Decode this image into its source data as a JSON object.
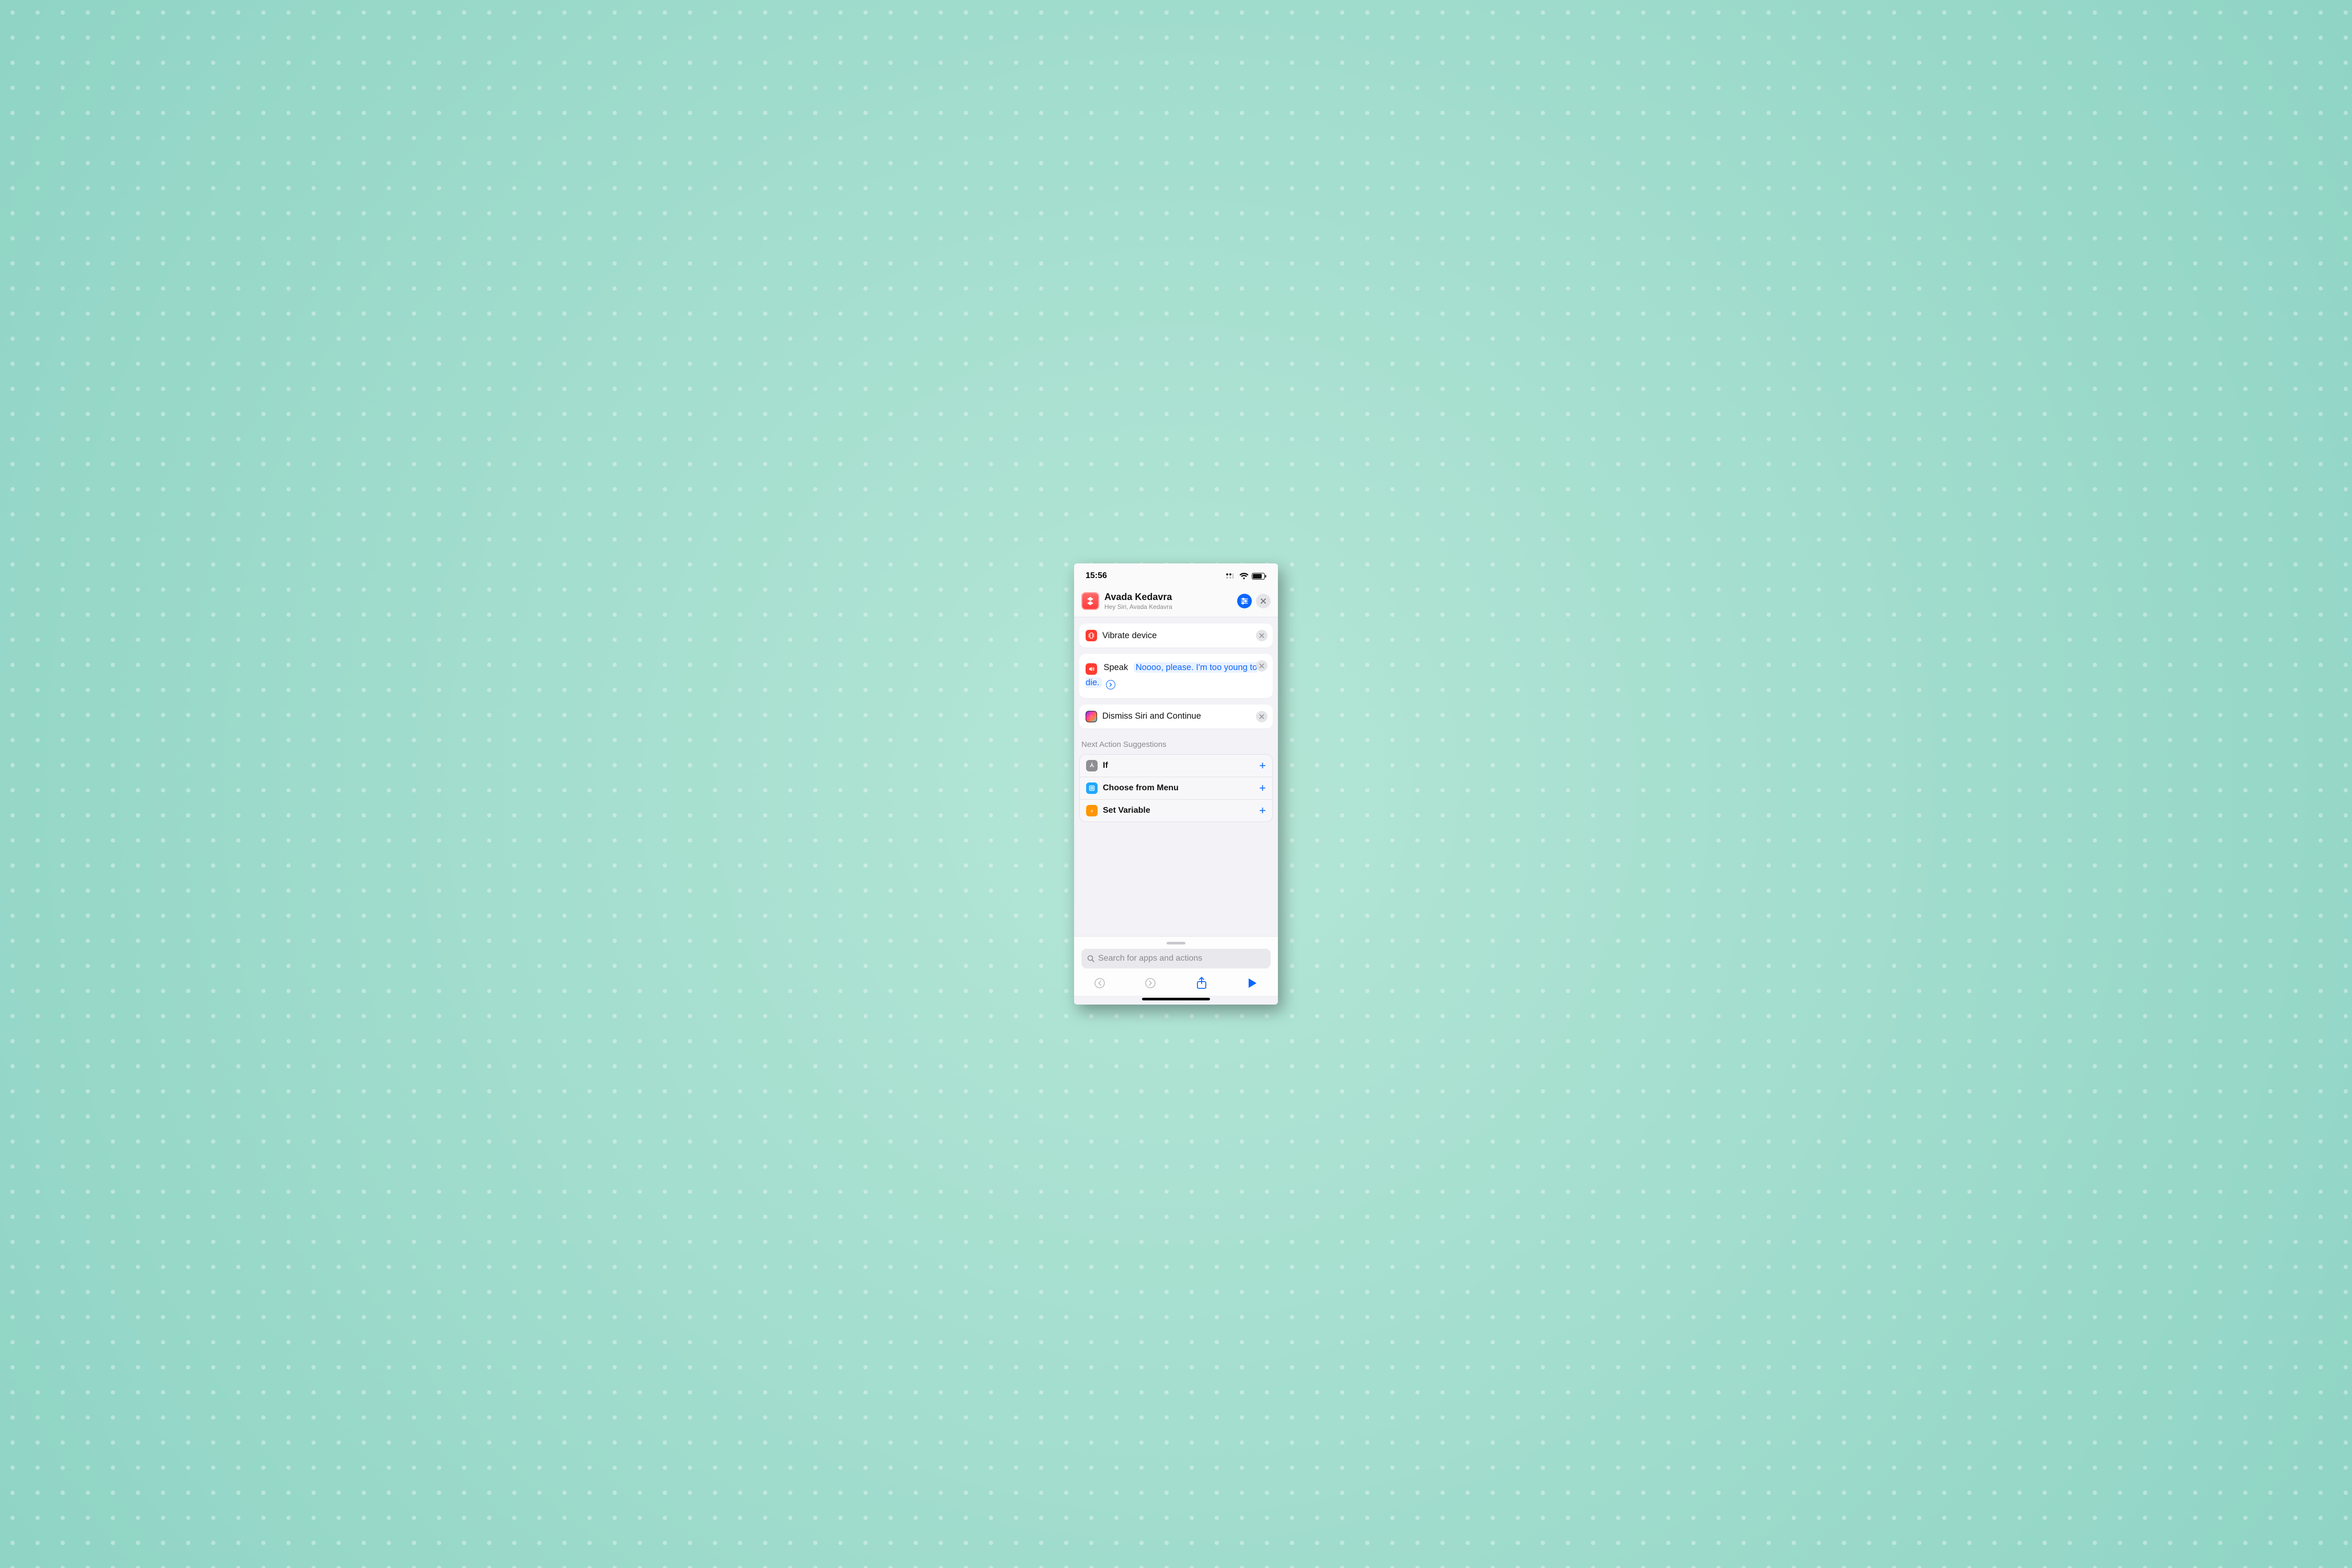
{
  "status": {
    "time": "15:56"
  },
  "header": {
    "title": "Avada Kedavra",
    "subtitle": "Hey Siri, Avada Kedavra"
  },
  "actions": {
    "vibrate": {
      "label": "Vibrate device"
    },
    "speak": {
      "label": "Speak",
      "text": "Noooo, please. I'm too young to die."
    },
    "dismiss": {
      "label": "Dismiss Siri and Continue"
    }
  },
  "suggestions": {
    "header": "Next Action Suggestions",
    "items": [
      {
        "label": "If"
      },
      {
        "label": "Choose from Menu"
      },
      {
        "label": "Set Variable"
      }
    ]
  },
  "search": {
    "placeholder": "Search for apps and actions"
  }
}
